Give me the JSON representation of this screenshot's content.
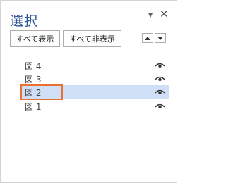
{
  "pane": {
    "title": "選択"
  },
  "buttons": {
    "show_all": "すべて表示",
    "hide_all": "すべて非表示"
  },
  "items": [
    {
      "label": "図 4",
      "selected": false
    },
    {
      "label": "図 3",
      "selected": false
    },
    {
      "label": "図 2",
      "selected": true
    },
    {
      "label": "図 1",
      "selected": false
    }
  ],
  "colors": {
    "title": "#2f5597",
    "selected_row": "#cfdff6",
    "highlight_border": "#ec7130"
  },
  "icons": {
    "eye": "eye-icon",
    "close": "close-icon",
    "pin": "pane-options-icon"
  }
}
